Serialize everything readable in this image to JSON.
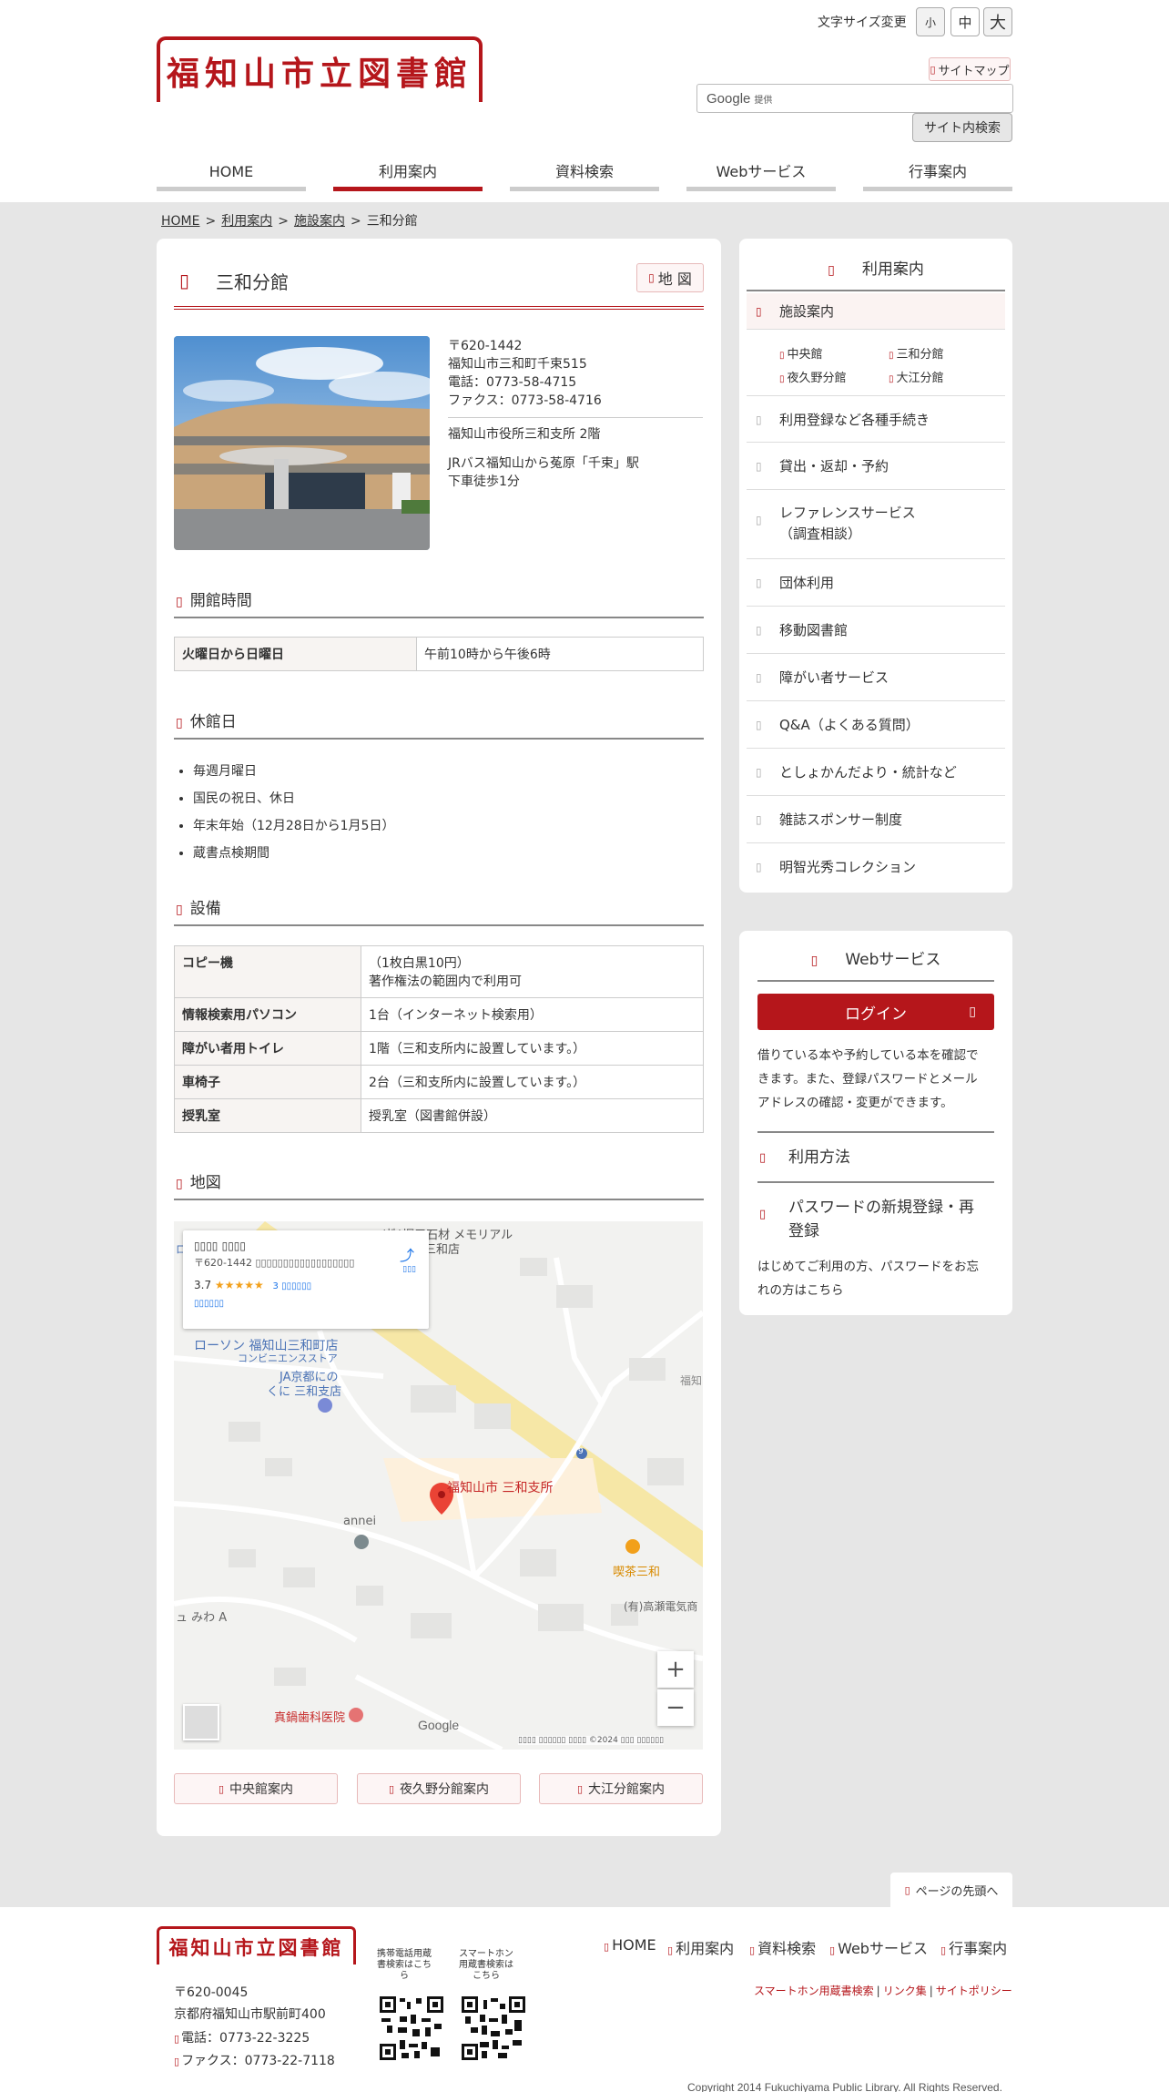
{
  "header": {
    "logo_text": "福知山市立図書館",
    "font_size_label": "文字サイズ変更",
    "font_sizes": [
      "小",
      "中",
      "大"
    ],
    "sitemap": "サイトマップ",
    "search_brand": "Google",
    "search_brand_sub": "提供",
    "search_button": "サイト内検索",
    "nav": [
      "HOME",
      "利用案内",
      "資料検索",
      "Webサービス",
      "行事案内"
    ],
    "active_nav": "利用案内"
  },
  "breadcrumb": [
    "HOME",
    "利用案内",
    "施設案内",
    "三和分館"
  ],
  "page": {
    "title": "三和分館",
    "map_button": "地 図",
    "address_lines": [
      "〒620-1442",
      "福知山市三和町千束515",
      "電話：0773-58-4715",
      "ファクス：0773-58-4716"
    ],
    "location": "福知山市役所三和支所 2階",
    "access": [
      "JRバス福知山から菟原「千束」駅",
      "下車徒歩1分"
    ]
  },
  "hours": {
    "heading": "開館時間",
    "rows": [
      {
        "label": "火曜日から日曜日",
        "value": "午前10時から午後6時"
      }
    ]
  },
  "closed": {
    "heading": "休館日",
    "items": [
      "毎週月曜日",
      "国民の祝日、休日",
      "年末年始（12月28日から1月5日）",
      "蔵書点検期間"
    ]
  },
  "facilities": {
    "heading": "設備",
    "rows": [
      {
        "label": "コピー機",
        "value1": "（1枚白黒10円）",
        "value2": "著作権法の範囲内で利用可"
      },
      {
        "label": "情報検索用パソコン",
        "value1": "1台（インターネット検索用）"
      },
      {
        "label": "障がい者用トイレ",
        "value1": "1階（三和支所内に設置しています。）"
      },
      {
        "label": "車椅子",
        "value1": "2台（三和支所内に設置しています。）"
      },
      {
        "label": "授乳室",
        "value1": "授乳室（図書館併設）"
      }
    ]
  },
  "map": {
    "heading": "地図",
    "info_title": "▯▯▯▯ ▯▯▯▯",
    "info_address": "〒620-1442 ▯▯▯▯▯▯▯▯▯▯▯▯▯▯▯▯▯▯",
    "rating": "3.7",
    "stars": "★★★★★",
    "reviews": "3 ▯▯▯▯▯▯",
    "larger_map": "▯▯▯▯▯▯",
    "route_label": "▯▯▯",
    "labels": {
      "stone": "(株)堀口石材 メモリアル",
      "stone2": "ン三和店",
      "lawson": "ローソン 福知山三和町店",
      "lawson_sub": "コンビニエンスストア",
      "ja1": "JA京都にの",
      "ja2": "くに 三和支店",
      "main": "福知山市 三和支所",
      "annei": "annei",
      "cafe": "喫茶三和",
      "takase": "(有)高瀬電気商",
      "miwa": "ュ みわ A",
      "dental": "真鍋歯科医院",
      "fuku": "福知",
      "route": "9",
      "google": "Google",
      "attrib": "▯▯▯▯ ▯▯▯▯▯▯ ▯▯▯▯ ©2024 ▯▯▯ ▯▯▯▯▯▯",
      "blue": "ロ"
    },
    "zoom_in": "+",
    "zoom_out": "−"
  },
  "branches": [
    "中央館案内",
    "夜久野分館案内",
    "大江分館案内"
  ],
  "side_menu": {
    "title": "利用案内",
    "active": "施設案内",
    "sub": [
      "中央館",
      "三和分館",
      "夜久野分館",
      "大江分館"
    ],
    "items": [
      "利用登録など各種手続き",
      "貸出・返却・予約",
      "レファレンスサービス",
      "団体利用",
      "移動図書館",
      "障がい者サービス",
      "Q&A（よくある質問）",
      "としょかんだより・統計など",
      "雑誌スポンサー制度",
      "明智光秀コレクション"
    ],
    "reference_sub": "（調査相談）"
  },
  "web_service": {
    "title": "Webサービス",
    "login": "ログイン",
    "login_text": [
      "借りている本や予約している本を確認で",
      "きます。また、登録パスワードとメール",
      "アドレスの確認・変更ができます。"
    ],
    "usage": "利用方法",
    "password_1": "パスワードの新規登録・再",
    "password_2": "登録",
    "password_text": [
      "はじめてご利用の方、パスワードをお忘",
      "れの方はこちら"
    ]
  },
  "page_top": "ページの先頭へ",
  "footer": {
    "logo_text": "福知山市立図書館",
    "postal": "〒620-0045",
    "address": "京都府福知山市駅前町400",
    "tel": "電話：0773-22-3225",
    "fax": "ファクス：0773-22-7118",
    "qr1_label": [
      "携帯電話用蔵",
      "書検索はこち",
      "ら"
    ],
    "qr2_label": [
      "スマートホン",
      "用蔵書検索は",
      "こちら"
    ],
    "nav": [
      "HOME",
      "利用案内",
      "資料検索",
      "Webサービス",
      "行事案内"
    ],
    "links": [
      "スマートホン用蔵書検索",
      "リンク集",
      "サイトポリシー"
    ],
    "copyright": "Copyright 2014 Fukuchiyama Public Library. All Rights Reserved."
  },
  "colors": {
    "accent": "#b5161b",
    "background": "#e6e6e6"
  },
  "icons": {
    "bullet": "bookmark-icon",
    "arrow": "chevron-right-icon"
  }
}
